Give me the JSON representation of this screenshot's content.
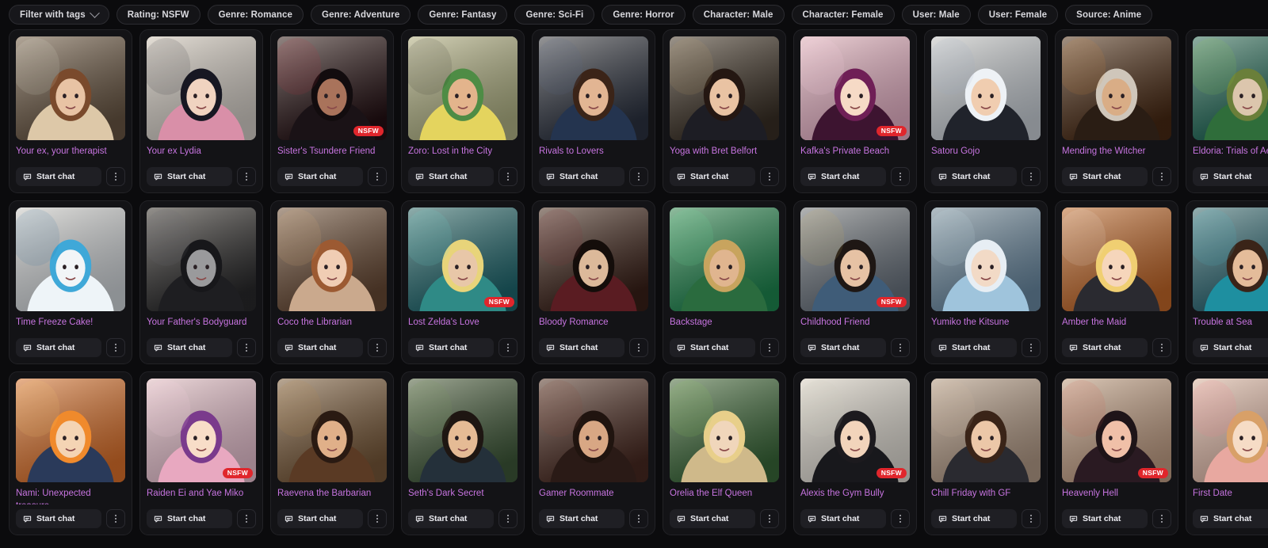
{
  "filter_bar": {
    "tag_filter_label": "Filter with tags",
    "chevron_icon": "chevron-down-icon",
    "chips": [
      "Rating: NSFW",
      "Genre: Romance",
      "Genre: Adventure",
      "Genre: Fantasy",
      "Genre: Sci-Fi",
      "Genre: Horror",
      "Character: Male",
      "Character: Female",
      "User: Male",
      "User: Female",
      "Source: Anime"
    ]
  },
  "labels": {
    "start_chat": "Start chat",
    "nsfw_badge": "NSFW",
    "chat_icon": "chat-bubble-icon",
    "more_icon": "more-vertical-icon"
  },
  "colors": {
    "page_background": "#0b0b0d",
    "card_background": "#131316",
    "card_border": "#222226",
    "title_text": "#c774e0",
    "nsfw_badge": "#e0262c",
    "button_background": "#1f1f24",
    "button_text": "#ececf1"
  },
  "cards": [
    {
      "title": "Your ex, your therapist",
      "nsfw": false,
      "art": {
        "bg": "linear-gradient(160deg,#6b5845,#3a2c21)",
        "skin": "#e8c3a4",
        "hair": "#7a4a2c",
        "cloth": "#ddc8a8",
        "accent": "#f2ece2"
      }
    },
    {
      "title": "Your ex Lydia",
      "nsfw": false,
      "art": {
        "bg": "linear-gradient(170deg,#dcd6cf,#8d8279)",
        "skin": "#f0d3c0",
        "hair": "#171722",
        "cloth": "#d98fa8",
        "accent": "#1b1b24"
      }
    },
    {
      "title": "Sister's Tsundere Friend",
      "nsfw": true,
      "art": {
        "bg": "linear-gradient(175deg,#241014,#0c0508)",
        "skin": "#a9735b",
        "hair": "#120c0e",
        "cloth": "#1a1216",
        "accent": "#c7343f"
      }
    },
    {
      "title": "Zoro: Lost in the City",
      "nsfw": false,
      "art": {
        "bg": "linear-gradient(170deg,#b7b98a,#6e7150)",
        "skin": "#e3b48c",
        "hair": "#4e8c45",
        "cloth": "#e4d45e",
        "accent": "#2a2d1e"
      }
    },
    {
      "title": "Rivals to Lovers",
      "nsfw": false,
      "art": {
        "bg": "linear-gradient(170deg,#2c3342,#10141c)",
        "skin": "#e2b593",
        "hair": "#3b2418",
        "cloth": "#24344f",
        "accent": "#5b6f8e"
      }
    },
    {
      "title": "Yoga with Bret Belfort",
      "nsfw": false,
      "art": {
        "bg": "linear-gradient(170deg,#3a3026,#131014)",
        "skin": "#e9c3a3",
        "hair": "#241712",
        "cloth": "#1d1d24",
        "accent": "#c9a56a"
      }
    },
    {
      "title": "Kafka's Private Beach",
      "nsfw": true,
      "art": {
        "bg": "linear-gradient(165deg,#f0b9cf,#b15d8e)",
        "skin": "#f6dac6",
        "hair": "#6f1f56",
        "cloth": "#3d1430",
        "accent": "#ffd6e8"
      }
    },
    {
      "title": "Satoru Gojo",
      "nsfw": false,
      "art": {
        "bg": "linear-gradient(170deg,#cfd6de,#6f7a88)",
        "skin": "#f0cdb0",
        "hair": "#eef2f6",
        "cloth": "#20232b",
        "accent": "#9fb0c4"
      }
    },
    {
      "title": "Mending the Witcher",
      "nsfw": false,
      "art": {
        "bg": "linear-gradient(170deg,#4a2a14,#170d08)",
        "skin": "#d9ad86",
        "hair": "#cfc6ba",
        "cloth": "#2a1d14",
        "accent": "#e08b3a"
      }
    },
    {
      "title": "Eldoria: Trials of Aeryn",
      "nsfw": false,
      "art": {
        "bg": "linear-gradient(165deg,#1e6b5a,#0e3a33)",
        "skin": "#dcc6ad",
        "hair": "#6a7f3a",
        "cloth": "#2f6d3a",
        "accent": "#8fd24a"
      }
    },
    {
      "title": "Time Freeze Cake!",
      "nsfw": false,
      "art": {
        "bg": "linear-gradient(170deg,#d8dde2,#aab4bd)",
        "skin": "#f2f5f7",
        "hair": "#3fa8d8",
        "cloth": "#eef4f8",
        "accent": "#2b6f9c"
      }
    },
    {
      "title": "Your Father's Bodyguard",
      "nsfw": false,
      "art": {
        "bg": "linear-gradient(170deg,#2a2a2c,#0c0c0d)",
        "skin": "#9a9a9c",
        "hair": "#17171a",
        "cloth": "#1e1e21",
        "accent": "#6f6f74"
      }
    },
    {
      "title": "Coco the Librarian",
      "nsfw": false,
      "art": {
        "bg": "linear-gradient(170deg,#6a4b36,#2a1c12)",
        "skin": "#f0cdb4",
        "hair": "#9c5a32",
        "cloth": "#caa98d",
        "accent": "#e3b77f"
      }
    },
    {
      "title": "Lost Zelda's Love",
      "nsfw": true,
      "art": {
        "bg": "linear-gradient(170deg,#1f6a72,#0c2f36)",
        "skin": "#e8c7a8",
        "hair": "#e8d47a",
        "cloth": "#2f8a86",
        "accent": "#6fe0d2"
      }
    },
    {
      "title": "Bloody Romance",
      "nsfw": false,
      "art": {
        "bg": "linear-gradient(170deg,#3a2018,#120808)",
        "skin": "#dcb99a",
        "hair": "#140d0a",
        "cloth": "#5a1c22",
        "accent": "#8f3038"
      }
    },
    {
      "title": "Backstage",
      "nsfw": false,
      "art": {
        "bg": "linear-gradient(170deg,#1f8a52,#07301d)",
        "skin": "#e0b58f",
        "hair": "#c8a45e",
        "cloth": "#2a6b3e",
        "accent": "#6ee59b"
      }
    },
    {
      "title": "Childhood Friend",
      "nsfw": true,
      "art": {
        "bg": "linear-gradient(170deg,#6c7682,#262c33)",
        "skin": "#e6c2a4",
        "hair": "#1e1714",
        "cloth": "#3f5c78",
        "accent": "#d8b25a"
      }
    },
    {
      "title": "Yumiko the Kitsune",
      "nsfw": false,
      "art": {
        "bg": "linear-gradient(170deg,#6d8ea8,#2a3c4e)",
        "skin": "#f2dac6",
        "hair": "#e7eef4",
        "cloth": "#9fc4dc",
        "accent": "#cfe6f2"
      }
    },
    {
      "title": "Amber the Maid",
      "nsfw": false,
      "art": {
        "bg": "linear-gradient(170deg,#c86a2a,#5e2a10)",
        "skin": "#f6d6bb",
        "hair": "#f0cf72",
        "cloth": "#2a2a30",
        "accent": "#f5f0e6"
      }
    },
    {
      "title": "Trouble at Sea",
      "nsfw": false,
      "art": {
        "bg": "linear-gradient(170deg,#2a6a78,#0e2a33)",
        "skin": "#e4bc9a",
        "hair": "#3a2418",
        "cloth": "#1e8fa0",
        "accent": "#46c8d8"
      }
    },
    {
      "title": "Nami: Unexpected treasure",
      "nsfw": false,
      "art": {
        "bg": "linear-gradient(170deg,#e3742c,#7e3a10)",
        "skin": "#f4d4b4",
        "hair": "#f08a2c",
        "cloth": "#2a3a5a",
        "accent": "#ffcf70"
      }
    },
    {
      "title": "Raiden Ei and Yae Miko",
      "nsfw": true,
      "art": {
        "bg": "linear-gradient(170deg,#f0c8d8,#a06a9c)",
        "skin": "#f8ddc8",
        "hair": "#7a3a8c",
        "cloth": "#e8a8c0",
        "accent": "#ffd9e8"
      }
    },
    {
      "title": "Raevena the Barbarian",
      "nsfw": false,
      "art": {
        "bg": "linear-gradient(170deg,#7a5a3a,#2a1c12)",
        "skin": "#e0b089",
        "hair": "#2a1a12",
        "cloth": "#5a3a24",
        "accent": "#c08a4a"
      }
    },
    {
      "title": "Seth's Dark Secret",
      "nsfw": false,
      "art": {
        "bg": "linear-gradient(170deg,#3f5a3a,#16241a)",
        "skin": "#e5bb95",
        "hair": "#1e1612",
        "cloth": "#24303a",
        "accent": "#7aa05c"
      }
    },
    {
      "title": "Gamer Roommate",
      "nsfw": false,
      "art": {
        "bg": "linear-gradient(170deg,#4a2a22,#160c0a)",
        "skin": "#d8a784",
        "hair": "#20140f",
        "cloth": "#2a1a16",
        "accent": "#8a4a38"
      }
    },
    {
      "title": "Orelia the Elf Queen",
      "nsfw": false,
      "art": {
        "bg": "linear-gradient(170deg,#3a6a3a,#12301c)",
        "skin": "#f0d6bb",
        "hair": "#e8cf8a",
        "cloth": "#cfb98a",
        "accent": "#8fd05a"
      }
    },
    {
      "title": "Alexis the Gym Bully",
      "nsfw": true,
      "art": {
        "bg": "linear-gradient(170deg,#e8e4dc,#9a958c)",
        "skin": "#f2d4bb",
        "hair": "#1c1a1e",
        "cloth": "#18181c",
        "accent": "#cfcac0"
      }
    },
    {
      "title": "Chill Friday with GF",
      "nsfw": false,
      "art": {
        "bg": "linear-gradient(170deg,#b9a08c,#574538)",
        "skin": "#ecc7a8",
        "hair": "#3a2418",
        "cloth": "#2a2a30",
        "accent": "#d8c0a4"
      }
    },
    {
      "title": "Heavenly Hell",
      "nsfw": true,
      "art": {
        "bg": "linear-gradient(170deg,#c8a48a,#3a2018)",
        "skin": "#f0c0a8",
        "hair": "#1e1418",
        "cloth": "#2a1a22",
        "accent": "#d85a4a"
      }
    },
    {
      "title": "First Date",
      "nsfw": false,
      "art": {
        "bg": "linear-gradient(170deg,#e8c0b0,#8a5a4a)",
        "skin": "#f6dcc6",
        "hair": "#d8a068",
        "cloth": "#e8a8a0",
        "accent": "#ff7a8a"
      }
    }
  ]
}
